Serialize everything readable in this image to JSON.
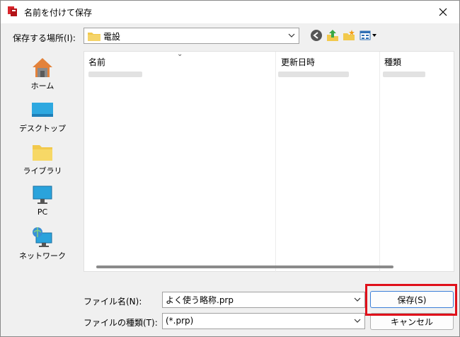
{
  "window": {
    "title": "名前を付けて保存"
  },
  "save_in": {
    "label": "保存する場所(I):",
    "value": "電設"
  },
  "places": [
    {
      "label": "ホーム",
      "icon": "home-icon"
    },
    {
      "label": "デスクトップ",
      "icon": "desktop-icon"
    },
    {
      "label": "ライブラリ",
      "icon": "library-folder-icon"
    },
    {
      "label": "PC",
      "icon": "computer-monitor-icon"
    },
    {
      "label": "ネットワーク",
      "icon": "network-icon"
    }
  ],
  "columns": {
    "name": "名前",
    "modified": "更新日時",
    "type": "種類"
  },
  "file_name": {
    "label": "ファイル名(N):",
    "value": "よく使う略称.prp"
  },
  "file_type": {
    "label": "ファイルの種類(T):",
    "value": "(*.prp)"
  },
  "buttons": {
    "save": "保存(S)",
    "cancel": "キャンセル"
  },
  "colors": {
    "highlight": "#e0101a",
    "accent": "#3c7fd8"
  }
}
